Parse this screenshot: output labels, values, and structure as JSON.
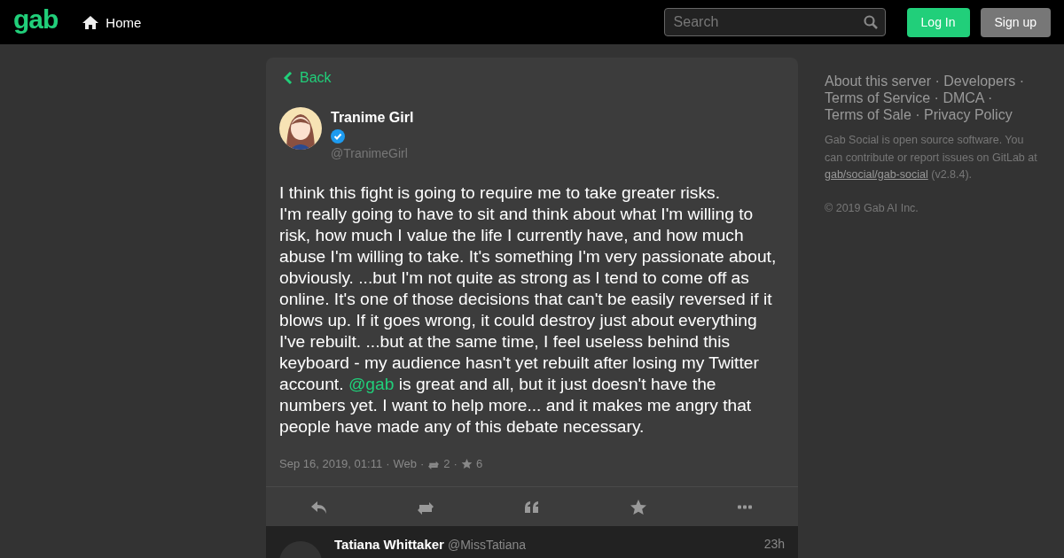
{
  "header": {
    "logo": "gab",
    "nav": [
      {
        "label": "Home"
      }
    ],
    "search": {
      "placeholder": "Search"
    },
    "buttons": [
      {
        "label": "Log In",
        "kind": "primary"
      },
      {
        "label": "Sign up",
        "kind": "secondary"
      }
    ]
  },
  "status": {
    "back": "Back",
    "author": {
      "name": "Tranime Girl",
      "verified": true,
      "handle": "@TranimeGirl"
    },
    "paragraphs": [
      [
        {
          "text": "I think this fight is going to require me to take greater risks."
        }
      ],
      [
        {
          "text": "I'm really going to have to sit and think about what I'm willing to risk, how much I value the life I currently have, and how much abuse I'm willing to take. It's something I'm very passionate about, obviously. ...but I'm not quite as strong as I tend to come off as online. It's one of those decisions that can't be easily reversed if it blows up. If it goes wrong, it could destroy just about everything I've rebuilt. ...but at the same time, I feel useless behind this keyboard - my audience hasn't yet rebuilt after losing my Twitter account. "
        },
        {
          "text": "@gab",
          "kind": "mention"
        },
        {
          "text": " is great and all, but it just doesn't have the numbers yet. I want to help more... and it makes me angry that people have made any of this debate necessary."
        }
      ]
    ],
    "separator": "·",
    "date": "Sep 16, 2019, 01:11",
    "app": "Web",
    "reposts": "2",
    "favourites": "6",
    "actions": [
      {
        "kind": "reply"
      },
      {
        "kind": "repost"
      },
      {
        "kind": "quote"
      },
      {
        "kind": "favourite"
      },
      {
        "kind": "more"
      }
    ]
  },
  "reply": {
    "name": "Tatiana Whittaker",
    "handle": "@MissTatiana",
    "time": "23h"
  },
  "sidebar": {
    "separator": "·",
    "links": [
      "About this server",
      "Developers",
      "Terms of Service",
      "DMCA",
      "Terms of Sale",
      "Privacy Policy"
    ],
    "about": [
      {
        "text": "Gab Social is open source software. You can contribute or report issues on GitLab at "
      },
      {
        "text": "gab/social/gab-social",
        "kind": "link"
      },
      {
        "text": " (v2.8.4)."
      }
    ],
    "copyright": "© 2019 Gab AI Inc."
  }
}
